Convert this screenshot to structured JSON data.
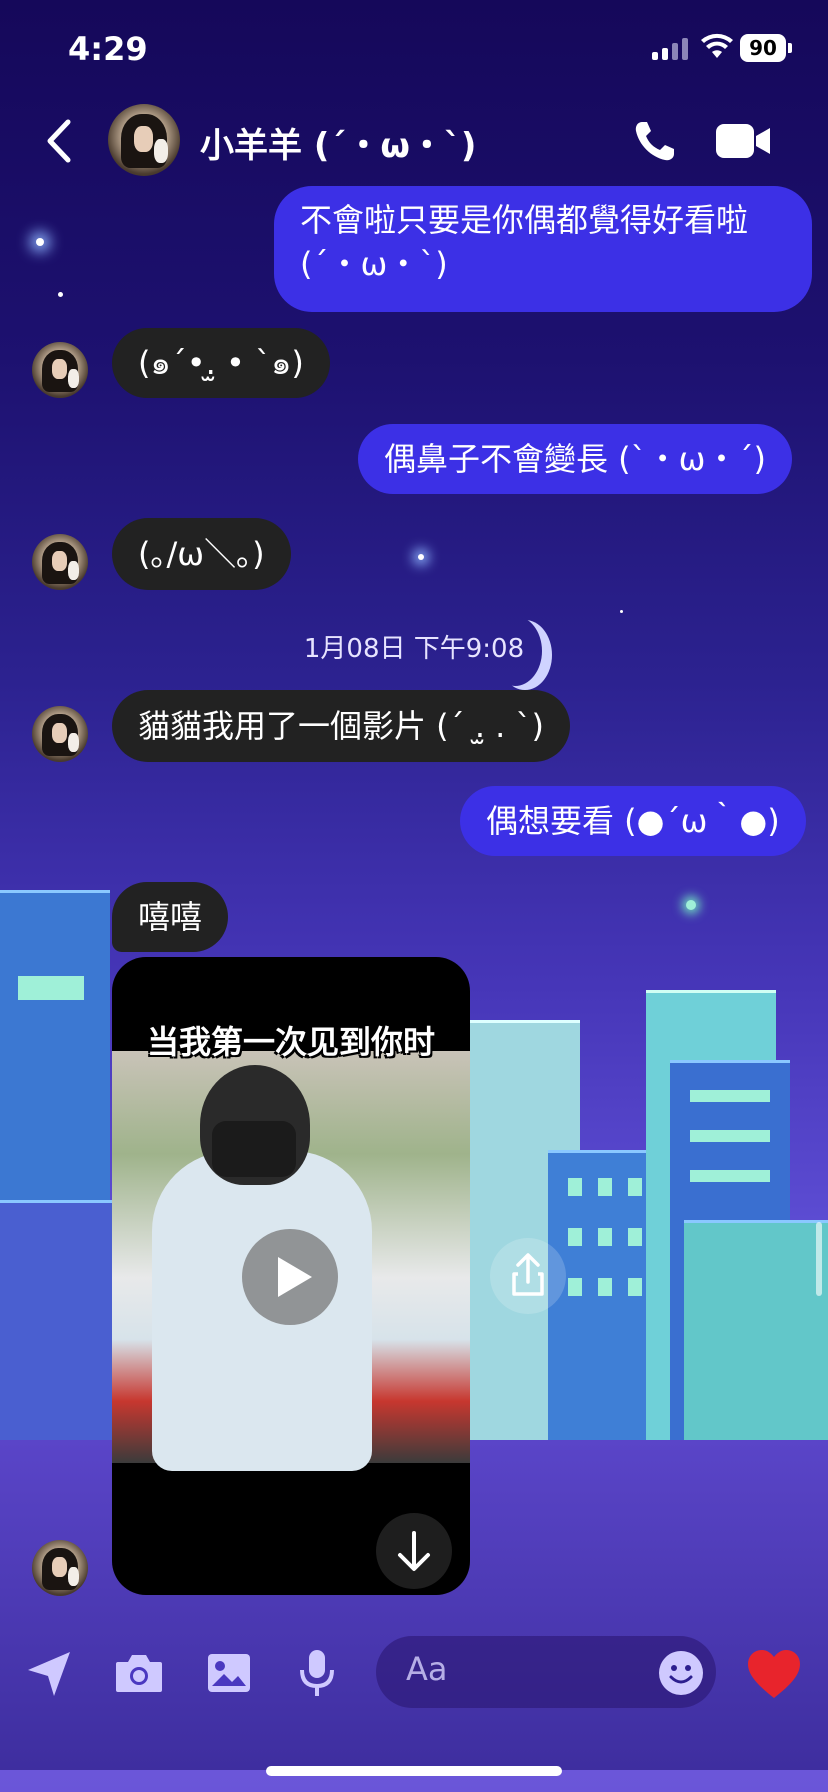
{
  "status_bar": {
    "time": "4:29",
    "battery": "90"
  },
  "header": {
    "contact_name": "小羊羊 (´・ω・`)"
  },
  "messages": [
    {
      "from": "me",
      "line1": "不會啦只要是你偶都覺得好看啦",
      "line2": "(´・ω・`)"
    },
    {
      "from": "them",
      "text": "(๑´•.̫ • `๑)"
    },
    {
      "from": "me",
      "text": "偶鼻子不會變長 (`・ω・´)"
    },
    {
      "from": "them",
      "text": "(｡/ω＼｡)"
    },
    {
      "from": "them",
      "text": "貓貓我用了一個影片 (´ .̫ . `)"
    },
    {
      "from": "me",
      "text": "偶想要看 (●´ω｀●)"
    },
    {
      "from": "them",
      "text": "嘻嘻"
    }
  ],
  "timestamp": "1月08日 下午9:08",
  "video": {
    "caption": "当我第一次见到你时"
  },
  "composer": {
    "placeholder": "Aa"
  },
  "icons": {
    "back": "chevron-left-icon",
    "call": "phone-icon",
    "video_call": "video-camera-icon",
    "location": "location-arrow-icon",
    "camera": "camera-icon",
    "gallery": "image-icon",
    "mic": "microphone-icon",
    "emoji": "smiley-icon",
    "like": "heart-icon",
    "share": "share-icon",
    "download": "download-arrow-icon",
    "play": "play-icon"
  },
  "colors": {
    "sent_bubble": "#3c30e6",
    "received_bubble": "#222222",
    "heart": "#e8242c"
  }
}
